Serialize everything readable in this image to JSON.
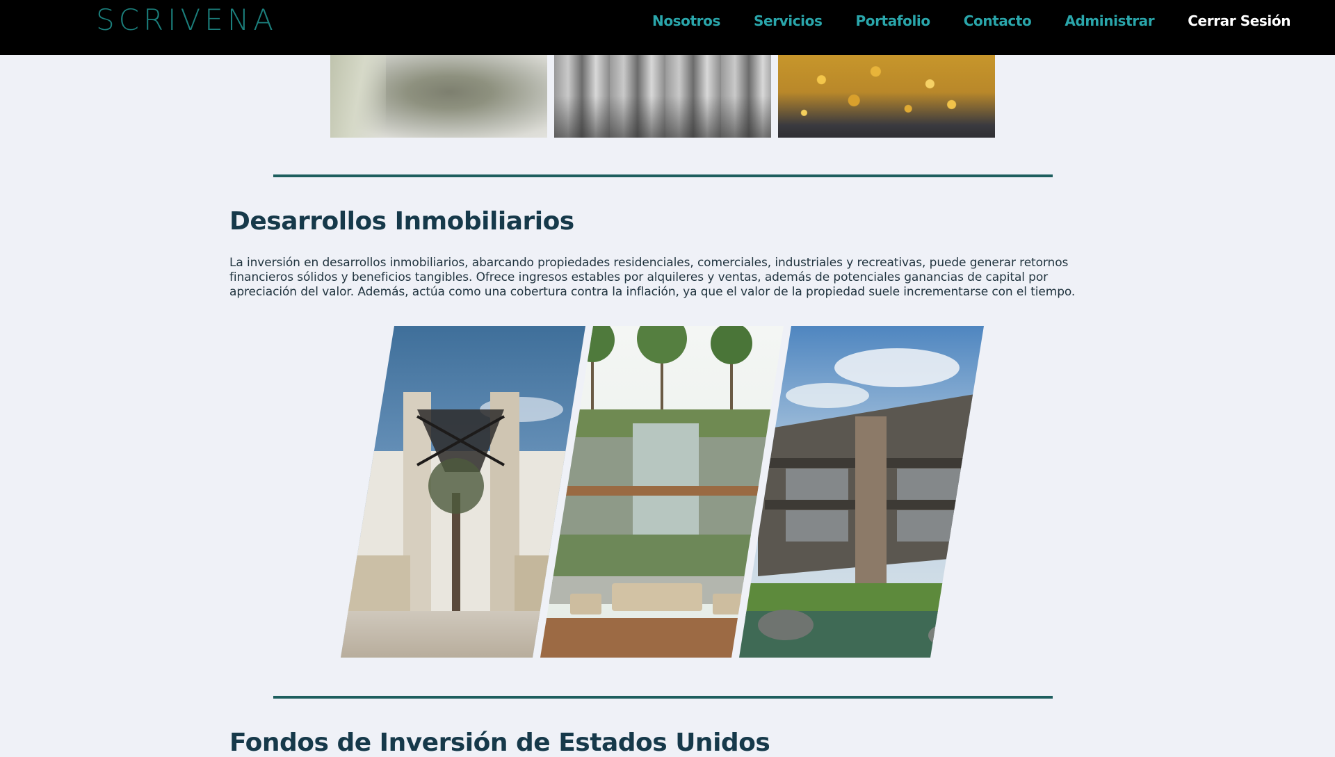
{
  "navbar": {
    "logo": "SCRIVENA",
    "links": [
      {
        "label": "Nosotros"
      },
      {
        "label": "Servicios"
      },
      {
        "label": "Portafolio"
      },
      {
        "label": "Contacto"
      },
      {
        "label": "Administrar"
      }
    ],
    "logout_label": "Cerrar Sesión",
    "link_color": "#2aa6ab",
    "background": "#000000"
  },
  "top_gallery": {
    "images": [
      {
        "icon": "mineral-powder-photo"
      },
      {
        "icon": "metal-bars-photo"
      },
      {
        "icon": "gold-nuggets-photo"
      }
    ]
  },
  "section_real_estate": {
    "title": "Desarrollos Inmobiliarios",
    "text": "La inversión en desarrollos inmobiliarios, abarcando propiedades residenciales, comerciales, industriales y recreativas, puede generar retornos financieros sólidos y beneficios tangibles. Ofrece ingresos estables por alquileres y ventas, además de potenciales ganancias de capital por apreciación del valor. Además, actúa como una cobertura contra la inflación, ya que el valor de la propiedad suele incrementarse con el tiempo.",
    "images": [
      {
        "icon": "modern-entrance-building-render"
      },
      {
        "icon": "tropical-terrace-lounge-render"
      },
      {
        "icon": "resort-building-lake-render"
      }
    ]
  },
  "section_us_funds": {
    "title": "Fondos de Inversión de Estados Unidos"
  },
  "colors": {
    "page_background": "#eff1f7",
    "divider": "#1d5e5e",
    "heading": "#16394a",
    "body_text": "#21343f"
  }
}
